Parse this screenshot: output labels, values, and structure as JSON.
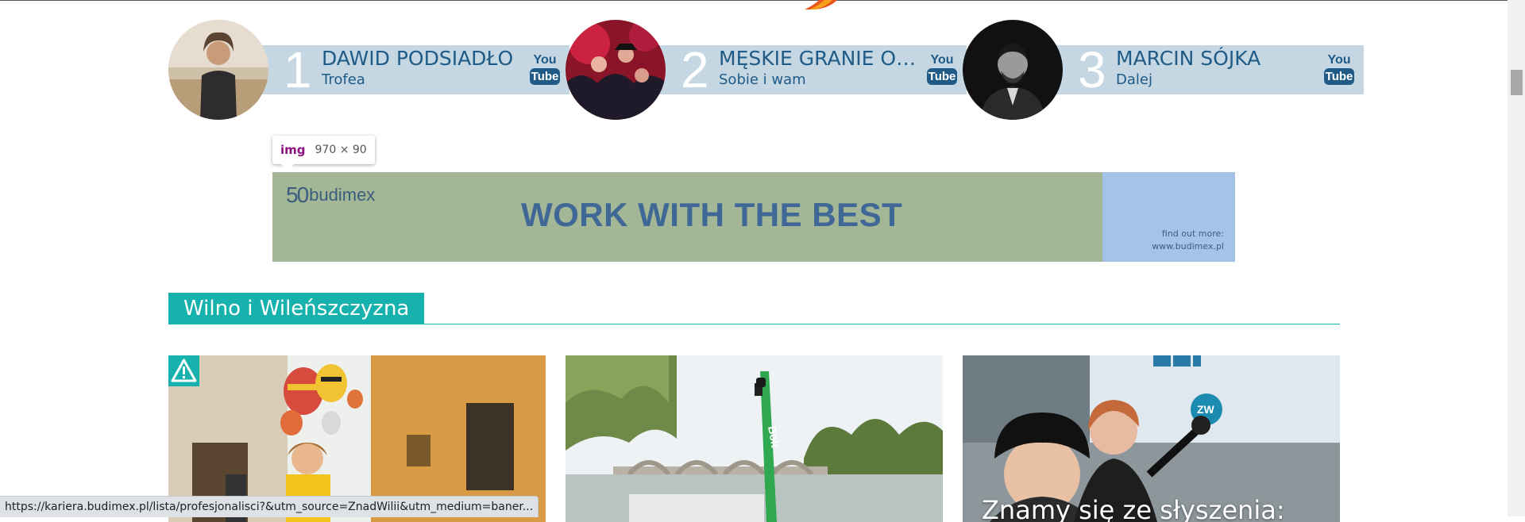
{
  "chart": {
    "items": [
      {
        "rank": "1",
        "artist": "DAWID PODSIADŁO",
        "song": "Trofea",
        "youtube": {
          "you": "You",
          "tube": "Tube"
        }
      },
      {
        "rank": "2",
        "artist": "MĘSKIE GRANIE OR...",
        "song": "Sobie i wam",
        "youtube": {
          "you": "You",
          "tube": "Tube"
        }
      },
      {
        "rank": "3",
        "artist": "MARCIN SÓJKA",
        "song": "Dalej",
        "youtube": {
          "you": "You",
          "tube": "Tube"
        }
      }
    ]
  },
  "devtools_tooltip": {
    "tag": "img",
    "dimensions": "970 × 90"
  },
  "banner": {
    "logo_number": "50",
    "logo_brand": "budimex",
    "headline": "WORK WITH THE BEST",
    "cta_line1": "find out more:",
    "cta_line2": "www.budimex.pl"
  },
  "section": {
    "title": "Wilno i Wileńszczyzna"
  },
  "cards": [
    {
      "image": "balloons-street-photo",
      "badge_icon": "warning-icon",
      "title": ""
    },
    {
      "image": "bolt-scooter-river-photo",
      "title": ""
    },
    {
      "image": "radio-studio-photo",
      "title": "Znamy się ze słyszenia:"
    }
  ],
  "status_bar": {
    "url": "https://kariera.budimex.pl/lista/profesjonalisci?&utm_source=ZnadWilii&utm_medium=baner..."
  },
  "colors": {
    "teal": "#17b2ad",
    "chart_bar": "#c5d7e2",
    "chart_text": "#1f5b86",
    "banner_green": "#a3b695",
    "banner_blue": "#a4c3e6"
  }
}
